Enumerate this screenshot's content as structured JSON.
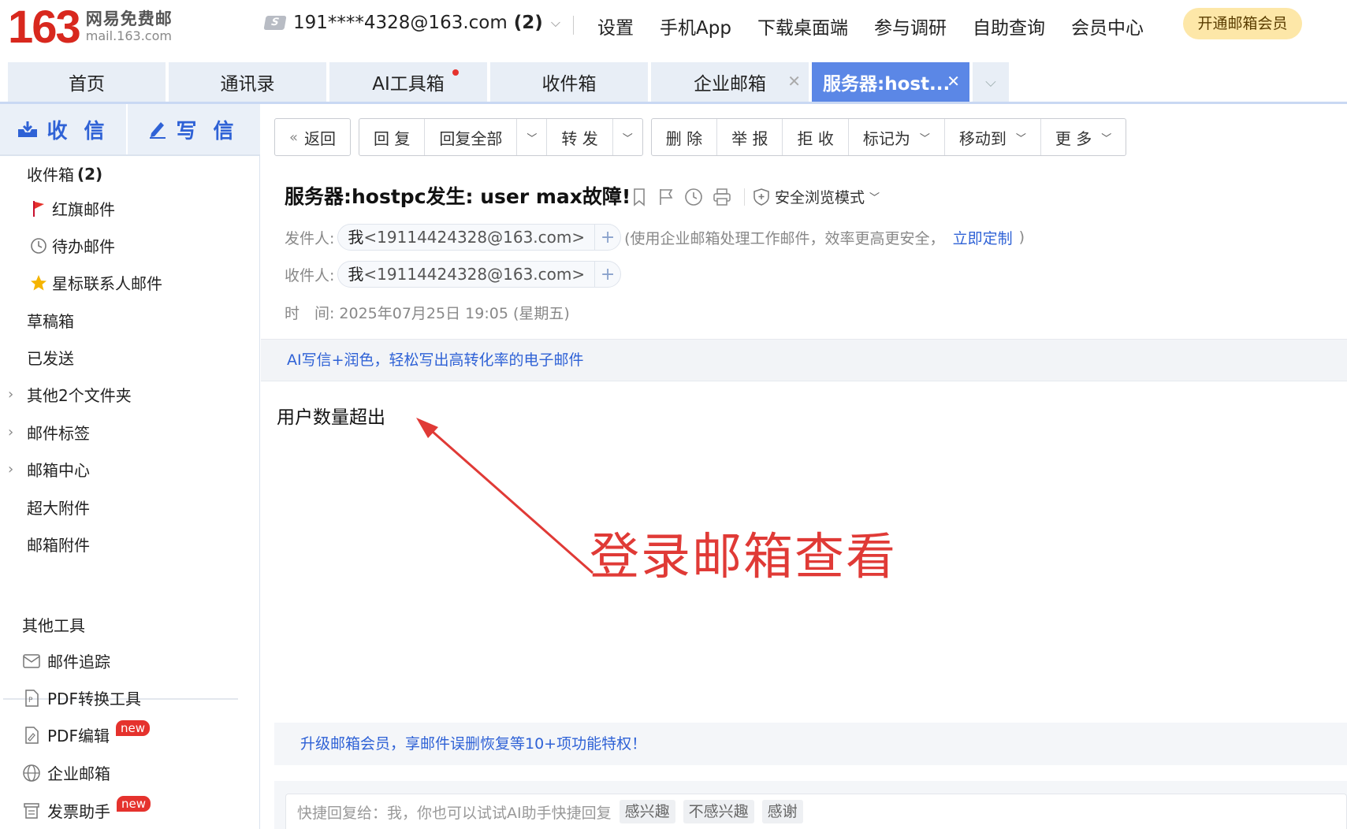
{
  "header": {
    "logo_number": "163",
    "logo_cn": "网易免费邮",
    "logo_en": "mail.163.com",
    "account_icon": "S",
    "account": "191****4328@163.com",
    "account_count": "(2)",
    "nav": [
      "设置",
      "手机App",
      "下载桌面端",
      "参与调研",
      "自助查询",
      "会员中心"
    ],
    "vip_button": "开通邮箱会员"
  },
  "tabs": [
    {
      "label": "首页"
    },
    {
      "label": "通讯录"
    },
    {
      "label": "AI工具箱"
    },
    {
      "label": "收件箱"
    },
    {
      "label": "企业邮箱"
    },
    {
      "label": "服务器:host..."
    }
  ],
  "sidebar": {
    "receive": "收 信",
    "compose": "写 信",
    "inbox_label": "收件箱",
    "inbox_count": "(2)",
    "folders": [
      "红旗邮件",
      "待办邮件",
      "星标联系人邮件",
      "草稿箱",
      "已发送",
      "其他2个文件夹",
      "邮件标签",
      "邮箱中心",
      "超大附件",
      "邮箱附件"
    ],
    "tools_title": "其他工具",
    "tools": [
      "邮件追踪",
      "PDF转换工具",
      "PDF编辑",
      "企业邮箱",
      "发票助手"
    ],
    "new_badge": "new"
  },
  "toolbar": {
    "back": "返回",
    "reply": "回 复",
    "reply_all": "回复全部",
    "forward": "转 发",
    "delete": "删 除",
    "report": "举 报",
    "reject": "拒 收",
    "mark_as": "标记为",
    "move_to": "移动到",
    "more": "更 多"
  },
  "mail": {
    "subject": "服务器:hostpc发生: user max故障!",
    "safe_mode": "安全浏览模式",
    "from_label": "发件人:",
    "from_name": "我",
    "from_addr": "<19114424328@163.com>",
    "from_note": "(使用企业邮箱处理工作邮件，效率更高更安全，",
    "from_link": "立即定制",
    "from_note_end": ")",
    "to_label": "收件人:",
    "to_name": "我",
    "to_addr": "<19114424328@163.com>",
    "time_label": "时　间:",
    "time_value": "2025年07月25日 19:05 (星期五)",
    "ai_promo": "AI写信+润色，轻松写出高转化率的电子邮件",
    "body": "用户数量超出",
    "annotation": "登录邮箱查看",
    "vip_promo": "升级邮箱会员，享邮件误删恢复等10+项功能特权！",
    "quick_reply": "快捷回复给：我，你也可以试试AI助手快捷回复",
    "quick_chips": [
      "感兴趣",
      "不感兴趣",
      "感谢"
    ]
  },
  "colors": {
    "brand_red": "#d8281e",
    "link_blue": "#2f62d6",
    "active_tab": "#5b87e6",
    "annotation_red": "#e03a36"
  }
}
